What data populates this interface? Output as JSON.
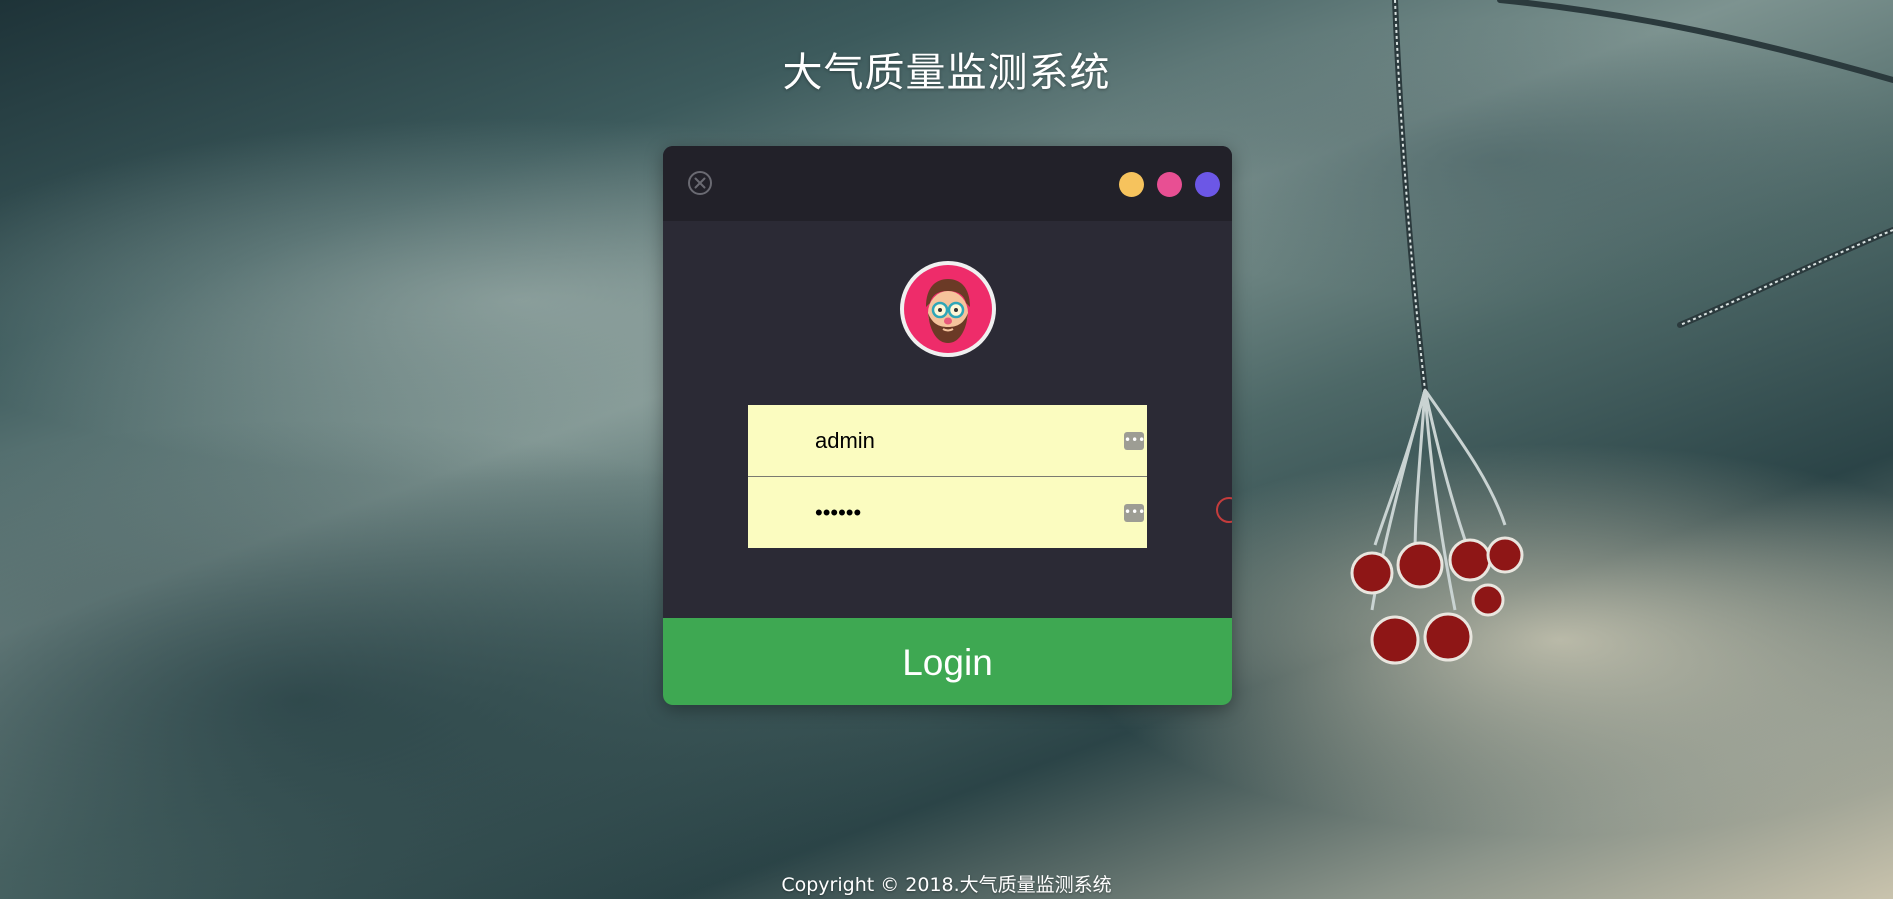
{
  "page": {
    "title": "大气质量监测系统",
    "footer": "Copyright © 2018.大气质量监测系统"
  },
  "window": {
    "close_icon": "close-circle-icon",
    "dots": [
      {
        "name": "yellow-dot",
        "color": "#f6c35d"
      },
      {
        "name": "pink-dot",
        "color": "#e84f93"
      },
      {
        "name": "purple-dot",
        "color": "#6c57e6"
      }
    ]
  },
  "avatar": {
    "icon": "bearded-man-with-glasses-avatar",
    "ring_color": "#ee2c6a"
  },
  "form": {
    "username": {
      "value": "admin",
      "icon": "more-dots-icon"
    },
    "password": {
      "value": "******",
      "icon": "more-dots-icon"
    }
  },
  "login_button": {
    "label": "Login",
    "color": "#3ea852"
  }
}
